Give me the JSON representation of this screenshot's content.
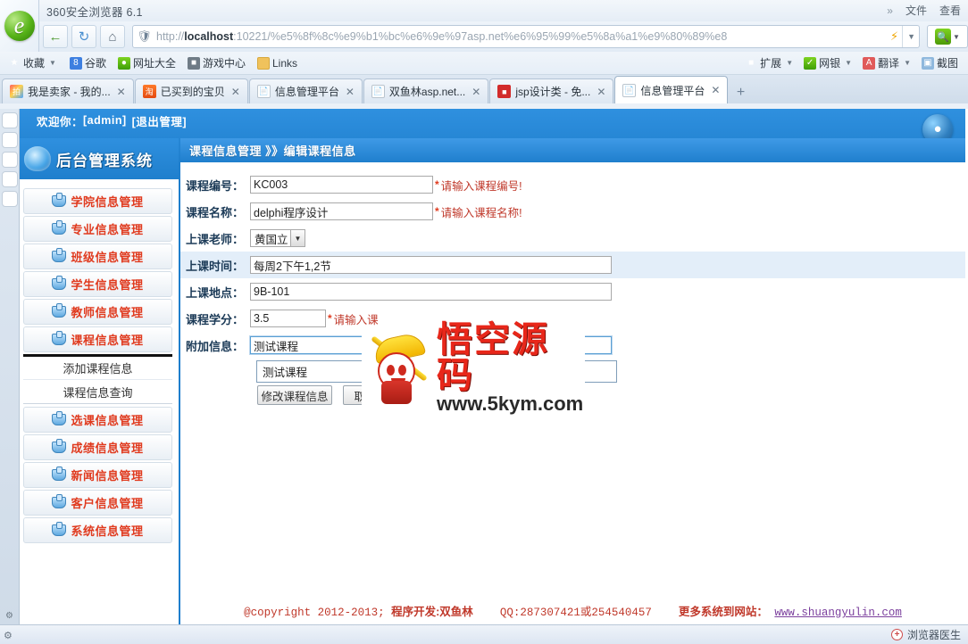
{
  "browser": {
    "window_title": "360安全浏览器 6.1",
    "title_menus": [
      "文件",
      "查看"
    ],
    "overflow_icon": "chevrons-right-icon",
    "nav": {
      "back": "back-icon",
      "refresh": "refresh-icon",
      "home": "home-icon",
      "shield": "shield-icon",
      "url_prefix": "http://",
      "url_host": "localhost",
      "url_rest": ":10221/%e5%8f%8c%e9%b1%bc%e6%9e%97asp.net%e6%95%99%e5%8a%a1%e9%80%89%e8",
      "flash_icon": "lightning-icon",
      "dropdown_icon": "chevron-down-icon",
      "search_icon": "search-icon"
    },
    "bookmarks": [
      {
        "label": "收藏",
        "icon": "star-icon",
        "caret": true
      },
      {
        "label": "谷歌",
        "icon": "google-icon",
        "caret": false
      },
      {
        "label": "网址大全",
        "icon": "web-icon",
        "caret": false
      },
      {
        "label": "游戏中心",
        "icon": "gamepad-icon",
        "caret": false
      },
      {
        "label": "Links",
        "icon": "folder-icon",
        "caret": false
      }
    ],
    "bookmarks_right": [
      {
        "label": "扩展",
        "icon": "extension-icon",
        "caret": true
      },
      {
        "label": "网银",
        "icon": "bank-shield-icon",
        "caret": true
      },
      {
        "label": "翻译",
        "icon": "translate-icon",
        "caret": true
      },
      {
        "label": "截图",
        "icon": "screenshot-icon",
        "caret": false
      }
    ],
    "tabs": [
      {
        "title": "我是卖家 - 我的...",
        "favicon": "paipai-icon",
        "active": false
      },
      {
        "title": "已买到的宝贝",
        "favicon": "taobao-icon",
        "active": false
      },
      {
        "title": "信息管理平台",
        "favicon": "page-icon",
        "active": false
      },
      {
        "title": "双鱼林asp.net...",
        "favicon": "page-icon",
        "active": false
      },
      {
        "title": "jsp设计类 - 免...",
        "favicon": "jsp-icon",
        "active": false
      },
      {
        "title": "信息管理平台",
        "favicon": "page-icon",
        "active": true
      }
    ],
    "new_tab_label": "+",
    "dock_icons": [
      "favorites-icon",
      "wechat-icon",
      "music-icon",
      "game-icon",
      "qq-icon"
    ],
    "status": {
      "doctor_label": "浏览器医生",
      "doctor_icon": "medic-cross-icon"
    }
  },
  "page": {
    "welcome_prefix": "欢迎你：",
    "welcome_user": "[admin]",
    "logout_label": "[退出管理]",
    "brand": "后台管理系统",
    "brand_icon": "system-orb-icon",
    "header_orb": "site-orb-icon",
    "breadcrumb": "课程信息管理 》》编辑课程信息",
    "sidebar": {
      "items": [
        {
          "label": "学院信息管理"
        },
        {
          "label": "专业信息管理"
        },
        {
          "label": "班级信息管理"
        },
        {
          "label": "学生信息管理"
        },
        {
          "label": "教师信息管理"
        },
        {
          "label": "课程信息管理"
        },
        {
          "label": "选课信息管理"
        },
        {
          "label": "成绩信息管理"
        },
        {
          "label": "新闻信息管理"
        },
        {
          "label": "客户信息管理"
        },
        {
          "label": "系统信息管理"
        }
      ],
      "submenu": [
        "添加课程信息",
        "课程信息查询"
      ]
    },
    "form": {
      "rows": [
        {
          "label": "课程编号：",
          "value": "KC003",
          "required": true,
          "hint": "请输入课程编号!",
          "type": "text"
        },
        {
          "label": "课程名称：",
          "value": "delphi程序设计",
          "required": true,
          "hint": "请输入课程名称!",
          "type": "text"
        },
        {
          "label": "上课老师：",
          "value": "黄国立",
          "required": false,
          "hint": "",
          "type": "select"
        },
        {
          "label": "上课时间：",
          "value": "每周2下午1,2节",
          "required": false,
          "hint": "",
          "type": "text"
        },
        {
          "label": "上课地点：",
          "value": "9B-101",
          "required": false,
          "hint": "",
          "type": "text"
        },
        {
          "label": "课程学分：",
          "value": "3.5",
          "required": true,
          "hint": "请输入课",
          "type": "text"
        },
        {
          "label": "附加信息：",
          "value": "测试课程",
          "required": false,
          "hint": "",
          "type": "text"
        }
      ],
      "autocomplete_item": "测试课程",
      "buttons": [
        {
          "label": "修改课程信息"
        },
        {
          "label": "取消"
        }
      ]
    },
    "watermark": {
      "cn": "悟空源码",
      "url": "www.5kym.com"
    },
    "footer": {
      "copyright": "@copyright 2012-2013;",
      "dev": "程序开发:双鱼林",
      "qq": "QQ:287307421或254540457",
      "more": "更多系统到网站：",
      "site": "www.shuangyulin.com"
    }
  },
  "colors": {
    "header_blue": "#1f7fcd",
    "menu_red": "#e03a1e",
    "footer_red": "#c0392b",
    "link_purple": "#7b3f9d",
    "watermark_red": "#e8271a"
  }
}
